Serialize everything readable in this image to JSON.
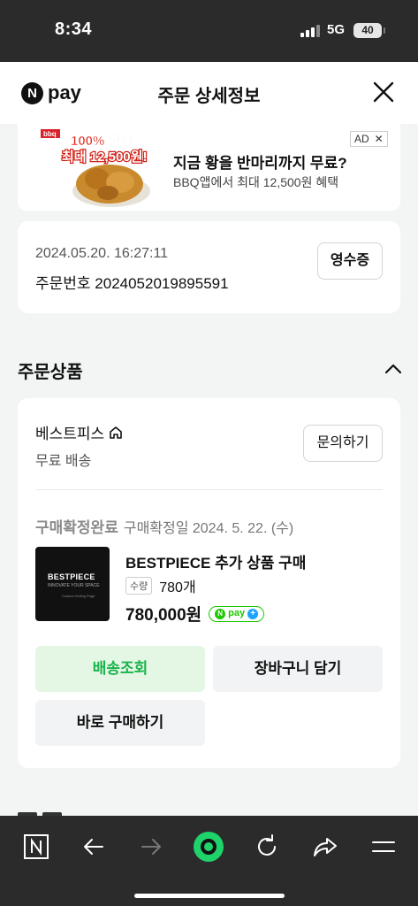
{
  "status_bar": {
    "time": "8:34",
    "network": "5G",
    "battery": "40"
  },
  "header": {
    "logo_letter": "N",
    "logo_text": "pay",
    "title": "주문 상세정보"
  },
  "ad": {
    "headline": "지금 황을 반마리까지 무료?",
    "subtext": "BBQ앱에서 최대 12,500원 혜택",
    "badge": "AD",
    "close": "✕",
    "image_text_1": "100% 당첨",
    "image_text_2": "최대 12,500원!",
    "image_brand": "bbq"
  },
  "order": {
    "date": "2024.05.20. 16:27:11",
    "number": "주문번호 2024052019895591",
    "receipt_label": "영수증"
  },
  "section": {
    "title": "주문상품"
  },
  "product_card": {
    "store_name": "베스트피스",
    "shipping": "무료 배송",
    "inquiry_label": "문의하기",
    "status_main": "구매확정완료",
    "status_sub": "구매확정일 2024. 5. 22. (수)",
    "thumb_title": "BESTPIECE",
    "thumb_sub": "INNOVATE YOUR SPACE",
    "thumb_small": "Custom Selling Page",
    "product_name": "BESTPIECE 추가 상품 구매",
    "qty_label": "수량",
    "qty_value": "780개",
    "price": "780,000원",
    "npay_text": "pay",
    "buttons": {
      "track": "배송조회",
      "cart": "장바구니 담기",
      "buy": "바로 구매하기"
    }
  },
  "colors": {
    "green": "#1ec800",
    "track_bg": "#e3f7e4",
    "track_text": "#1bb24c"
  }
}
